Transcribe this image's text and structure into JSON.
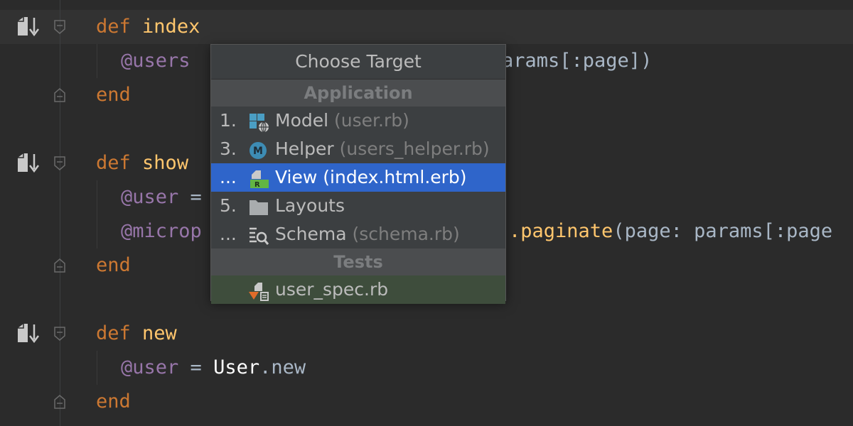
{
  "editor": {
    "lines": [
      {
        "kw": "def",
        "name": "index"
      },
      {
        "ivar": "@users",
        "tail": "arams[:page])"
      },
      {
        "kw": "end"
      },
      {
        "kw": "def",
        "name": "show"
      },
      {
        "ivar": "@user",
        "op": " ="
      },
      {
        "ivar": "@microp",
        "mth": ".paginate",
        "tail": "(page: params[:page"
      },
      {
        "kw": "end"
      },
      {
        "kw": "def",
        "name": "new"
      },
      {
        "ivar": "@user",
        "op": " = ",
        "const": "User",
        "dot": ".new"
      },
      {
        "kw": "end"
      }
    ]
  },
  "popup": {
    "title": "Choose Target",
    "sections": [
      {
        "header": "Application"
      },
      {
        "header": "Tests"
      }
    ],
    "items": [
      {
        "num": "1.",
        "icon": "model-icon",
        "label": "Model",
        "hint": "(user.rb)"
      },
      {
        "num": "3.",
        "icon": "helper-icon",
        "label": "Helper",
        "hint": "(users_helper.rb)"
      },
      {
        "num": "...",
        "icon": "view-icon",
        "label": "View (index.html.erb)",
        "hint": ""
      },
      {
        "num": "5.",
        "icon": "folder-icon",
        "label": "Layouts",
        "hint": ""
      },
      {
        "num": "...",
        "icon": "schema-icon",
        "label": "Schema",
        "hint": "(schema.rb)"
      },
      {
        "num": "",
        "icon": "spec-icon",
        "label": "user_spec.rb",
        "hint": ""
      }
    ]
  },
  "colors": {
    "background": "#2b2b2b",
    "keyword": "#cc7832",
    "function": "#ffc66d",
    "instance_var": "#9876aa",
    "selection": "#2f65ca"
  }
}
